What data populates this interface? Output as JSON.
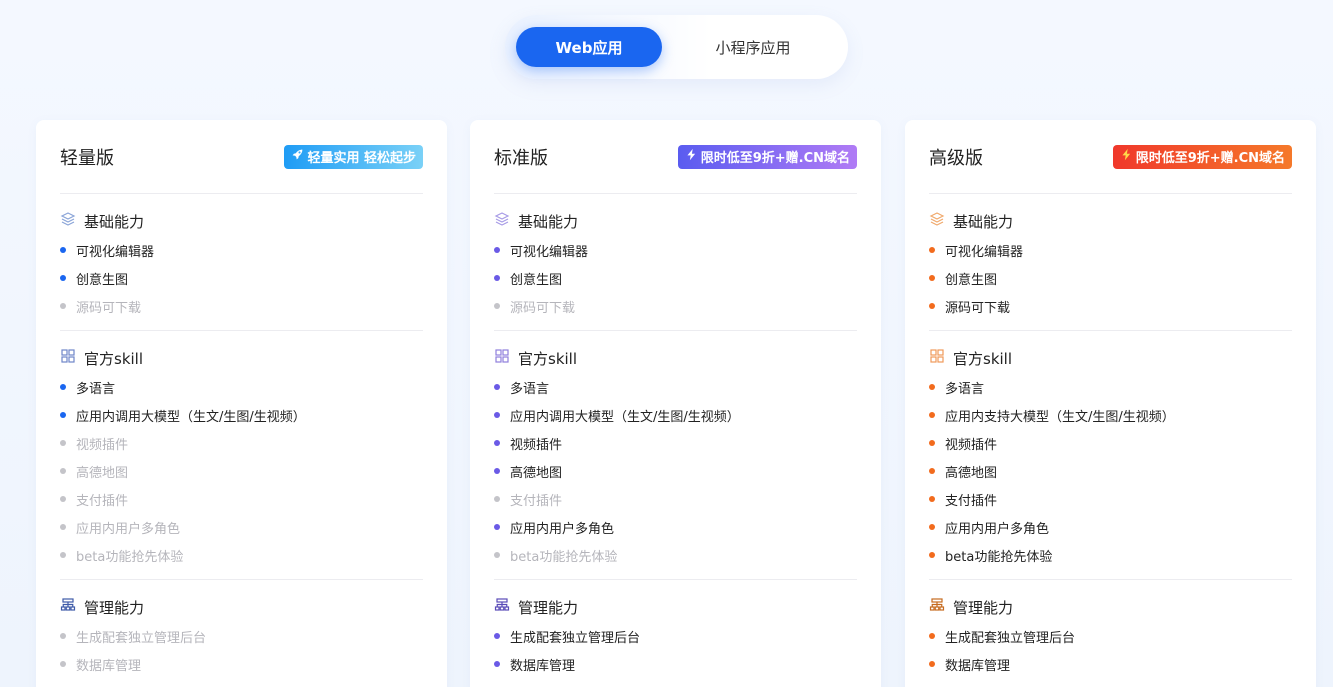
{
  "tabs": {
    "web": "Web应用",
    "miniprogram": "小程序应用"
  },
  "colors": {
    "primary": "#1a66f0",
    "standard": "#6a5ae6",
    "advanced": "#f26b1d",
    "disabled": "#b5b5bb"
  },
  "plans": [
    {
      "title": "轻量版",
      "badge": "轻量实用 轻松起步",
      "badge_icon": "rocket-icon",
      "sections": [
        {
          "title": "基础能力",
          "icon": "layers-icon",
          "items": [
            {
              "label": "可视化编辑器",
              "enabled": true
            },
            {
              "label": "创意生图",
              "enabled": true
            },
            {
              "label": "源码可下载",
              "enabled": false
            }
          ]
        },
        {
          "title": "官方skill",
          "icon": "grid-icon",
          "items": [
            {
              "label": "多语言",
              "enabled": true
            },
            {
              "label": "应用内调用大模型（生文/生图/生视频）",
              "enabled": true
            },
            {
              "label": "视频插件",
              "enabled": false
            },
            {
              "label": "高德地图",
              "enabled": false
            },
            {
              "label": "支付插件",
              "enabled": false
            },
            {
              "label": "应用内用户多角色",
              "enabled": false
            },
            {
              "label": "beta功能抢先体验",
              "enabled": false
            }
          ]
        },
        {
          "title": "管理能力",
          "icon": "org-chart-icon",
          "items": [
            {
              "label": "生成配套独立管理后台",
              "enabled": false
            },
            {
              "label": "数据库管理",
              "enabled": false
            }
          ]
        }
      ]
    },
    {
      "title": "标准版",
      "badge": "限时低至9折+赠.CN域名",
      "badge_icon": "lightning-icon",
      "sections": [
        {
          "title": "基础能力",
          "icon": "layers-icon",
          "items": [
            {
              "label": "可视化编辑器",
              "enabled": true
            },
            {
              "label": "创意生图",
              "enabled": true
            },
            {
              "label": "源码可下载",
              "enabled": false
            }
          ]
        },
        {
          "title": "官方skill",
          "icon": "grid-icon",
          "items": [
            {
              "label": "多语言",
              "enabled": true
            },
            {
              "label": "应用内调用大模型（生文/生图/生视频）",
              "enabled": true
            },
            {
              "label": "视频插件",
              "enabled": true
            },
            {
              "label": "高德地图",
              "enabled": true
            },
            {
              "label": "支付插件",
              "enabled": false
            },
            {
              "label": "应用内用户多角色",
              "enabled": true
            },
            {
              "label": "beta功能抢先体验",
              "enabled": false
            }
          ]
        },
        {
          "title": "管理能力",
          "icon": "org-chart-icon",
          "items": [
            {
              "label": "生成配套独立管理后台",
              "enabled": true
            },
            {
              "label": "数据库管理",
              "enabled": true
            }
          ]
        }
      ]
    },
    {
      "title": "高级版",
      "badge": "限时低至9折+赠.CN域名",
      "badge_icon": "lightning-icon",
      "sections": [
        {
          "title": "基础能力",
          "icon": "layers-icon",
          "items": [
            {
              "label": "可视化编辑器",
              "enabled": true
            },
            {
              "label": "创意生图",
              "enabled": true
            },
            {
              "label": "源码可下载",
              "enabled": true
            }
          ]
        },
        {
          "title": "官方skill",
          "icon": "grid-icon",
          "items": [
            {
              "label": "多语言",
              "enabled": true
            },
            {
              "label": "应用内支持大模型（生文/生图/生视频）",
              "enabled": true
            },
            {
              "label": "视频插件",
              "enabled": true
            },
            {
              "label": "高德地图",
              "enabled": true
            },
            {
              "label": "支付插件",
              "enabled": true
            },
            {
              "label": "应用内用户多角色",
              "enabled": true
            },
            {
              "label": "beta功能抢先体验",
              "enabled": true
            }
          ]
        },
        {
          "title": "管理能力",
          "icon": "org-chart-icon",
          "items": [
            {
              "label": "生成配套独立管理后台",
              "enabled": true
            },
            {
              "label": "数据库管理",
              "enabled": true
            }
          ]
        }
      ]
    }
  ]
}
